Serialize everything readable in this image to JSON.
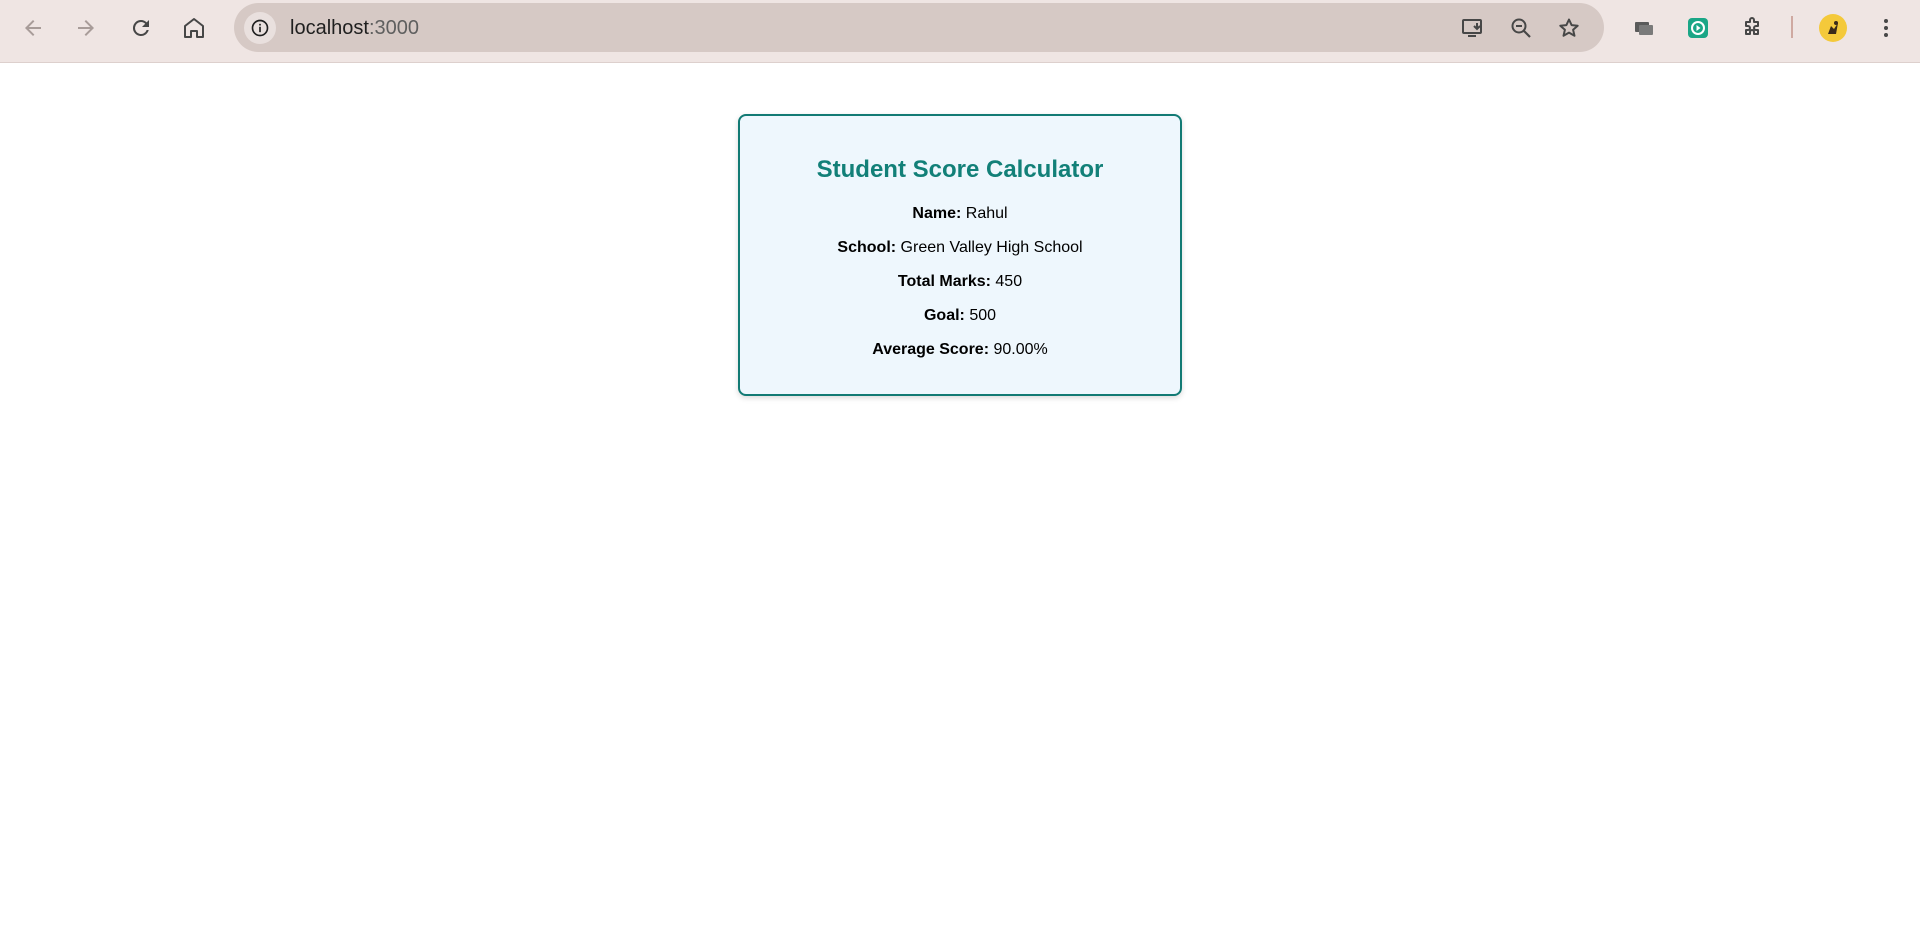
{
  "browser": {
    "url_host": "localhost",
    "url_port": ":3000",
    "icons": {
      "back": "arrow-left-icon",
      "forward": "arrow-right-icon",
      "reload": "reload-icon",
      "home": "home-icon",
      "site_info": "info-icon",
      "install": "install-app-icon",
      "zoom": "zoom-out-icon",
      "bookmark": "star-icon",
      "tab_search": "tab-group-icon",
      "extension_green": "extension-app-icon",
      "extensions": "puzzle-icon",
      "profile": "profile-avatar",
      "menu": "kebab-menu-icon"
    }
  },
  "card": {
    "title": "Student Score Calculator",
    "rows": [
      {
        "label": "Name:",
        "value": "Rahul"
      },
      {
        "label": "School:",
        "value": "Green Valley High School"
      },
      {
        "label": "Total Marks:",
        "value": "450"
      },
      {
        "label": "Goal:",
        "value": "500"
      },
      {
        "label": "Average Score:",
        "value": "90.00%"
      }
    ]
  },
  "colors": {
    "toolbar_bg": "#efe5e3",
    "omnibox_bg": "#d6c9c5",
    "card_bg": "#eef7fd",
    "card_border": "#127a74",
    "title": "#128078",
    "extension_green": "#1aa686"
  }
}
